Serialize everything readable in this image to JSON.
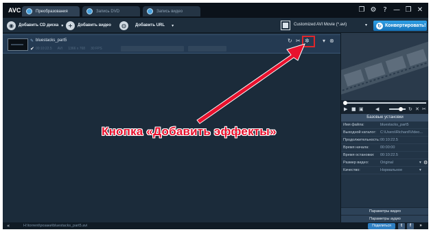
{
  "app": {
    "logo": "AVC",
    "tabs": [
      {
        "label": "Преобразования"
      },
      {
        "label": "Запись DVD"
      },
      {
        "label": "Запись видео"
      }
    ],
    "window_controls": [
      "❐",
      "⚙",
      "?",
      "—",
      "❐",
      "✕"
    ]
  },
  "toolbar": {
    "add_cd_label": "Добавить CD диска",
    "add_video_label": "Добавить видео",
    "add_url_label": "Добавить URL",
    "format_value": "Customized AVI Movie (*.avi)",
    "convert_label": "Конвертировать!"
  },
  "file": {
    "name": "bluestacks_part5",
    "meta": [
      "00:10:22.5",
      "AVI",
      "1366 x 768",
      "30 FPS"
    ]
  },
  "annotation": {
    "text": "Кнопка «Добавить эффекты»"
  },
  "settings": {
    "header": "Базовые установки",
    "rows": [
      {
        "label": "Имя файла:",
        "value": "bluestacks_part5"
      },
      {
        "label": "Выходной каталог:",
        "value": "C:\\Users\\Richard\\Video..."
      },
      {
        "label": "Продолжительность:",
        "value": "00:10:22.5"
      },
      {
        "label": "Время начала:",
        "value": "00:00:00"
      },
      {
        "label": "Время остановки:",
        "value": "00:10:22.5"
      },
      {
        "label": "Размер видео:",
        "value": "Original"
      },
      {
        "label": "Качество:",
        "value": "Нормальное"
      }
    ],
    "video_params_label": "Параметры видео",
    "audio_params_label": "Параметры аудио"
  },
  "status": {
    "path": "H:\\torrent\\розаки\\bluestacks_part5.avi",
    "share_label": "Поделиться"
  },
  "colors": {
    "annotation": "#e8112d",
    "highlight": "#e0262a",
    "accent": "#2ea0e6"
  }
}
